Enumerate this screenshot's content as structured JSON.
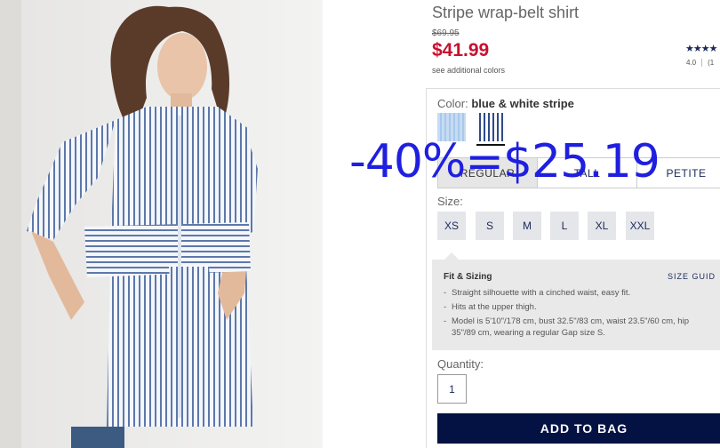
{
  "product": {
    "title": "Stripe wrap-belt shirt",
    "original_price": "$69.95",
    "sale_price": "$41.99",
    "see_colors": "see additional colors",
    "stars": "★★★★",
    "rating": "4.0",
    "review_count": "(1"
  },
  "color": {
    "label": "Color:",
    "selected": "blue & white stripe",
    "swatches": [
      "light-blue-stripe-swatch",
      "navy-white-stripe-swatch"
    ]
  },
  "fit_tabs": [
    "REGULAR",
    "TALL",
    "PETITE"
  ],
  "size": {
    "label": "Size:",
    "options": [
      "XS",
      "S",
      "M",
      "L",
      "XL",
      "XXL"
    ]
  },
  "fit_sizing": {
    "title": "Fit & Sizing",
    "size_guide": "SIZE GUID",
    "bullets": [
      "Straight silhouette with a cinched waist, easy fit.",
      "Hits at the upper thigh.",
      "Model is 5'10\"/178 cm, bust 32.5\"/83 cm, waist 23.5\"/60 cm, hip",
      "35\"/89 cm, wearing a regular Gap size S."
    ]
  },
  "quantity": {
    "label": "Quantity:",
    "value": "1"
  },
  "add_to_bag": "ADD TO BAG",
  "overlay": "-40%=$25.19",
  "colors": {
    "price_red": "#c8102e",
    "navy": "#041243",
    "overlay_blue": "#1f1fe0"
  }
}
